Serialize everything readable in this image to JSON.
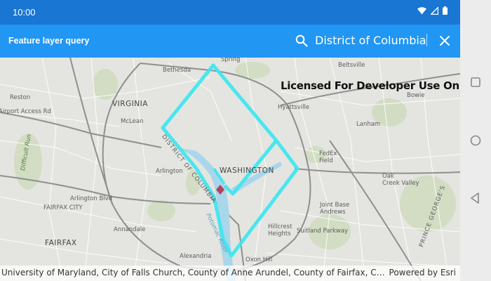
{
  "status_bar": {
    "time": "10:00"
  },
  "app_bar": {
    "title": "Feature layer query",
    "search_value": "District of Columbia"
  },
  "map": {
    "license_text": "Licensed For Developer Use Only",
    "labels": {
      "spring": "Spring",
      "bethesda": "Bethesda",
      "reston": "Reston",
      "virginia": "VIRGINIA",
      "mclean": "McLean",
      "hyattsville": "Hyattsville",
      "bowie": "Bowie",
      "arlington": "Arlington",
      "washington": "WASHINGTON",
      "fedex_field": "FedEx\nField",
      "oak_creek": "Oak\nCreek Valley",
      "arlington_blvd": "Arlington Blvd",
      "falls_church": "FAIRFAX CITY",
      "annandale": "Annandale",
      "alexandria": "Alexandria",
      "hillcrest": "Hillcrest\nHeights",
      "suitland": "Suitland Parkway",
      "oxon_hill": "Oxon Hill",
      "potomac_river": "Potomac River",
      "district_of_columbia": "DISTRICT OF COLUMBIA",
      "difficult_run": "Difficult Run",
      "prince_georges": "PRINCE GEORGE'S",
      "joint_base": "Joint Base\nAndrews",
      "access_rd": "Airport Access Rd",
      "fairfax_co": "FAIRFAX",
      "beltsville": "Beltsville",
      "lanham": "Lanham"
    },
    "attribution": "University of Maryland, City of Falls Church, County of Anne Arundel, County of Fairfax, County of Loudoun",
    "powered_by": "Powered by Esri"
  },
  "colors": {
    "status_bar": "#1976d2",
    "app_bar": "#2196f3",
    "boundary": "#3de6f0",
    "marker": "#b0445e",
    "river": "#a9d6ea"
  },
  "icons": {
    "search": "search-icon",
    "close": "close-icon",
    "wifi": "wifi-icon",
    "signal": "signal-icon",
    "battery": "battery-icon",
    "nav_back": "back-triangle-icon",
    "nav_home": "home-circle-icon",
    "nav_recent": "recent-square-icon"
  }
}
